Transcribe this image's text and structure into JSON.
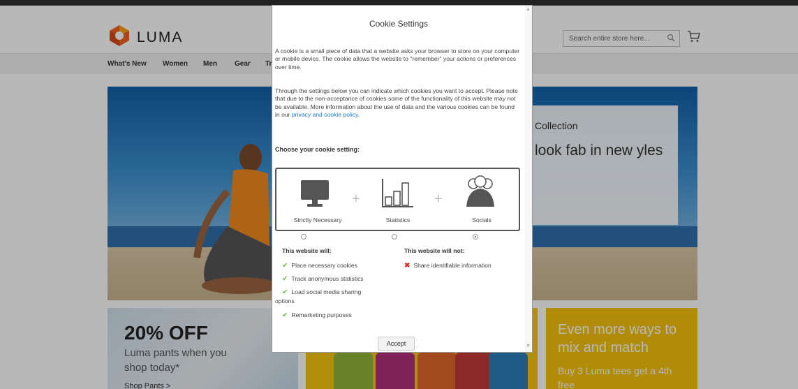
{
  "store": {
    "logo_text": "LUMA",
    "search_placeholder": "Search entire store here...",
    "nav": [
      "What's New",
      "Women",
      "Men",
      "Gear",
      "Tr"
    ],
    "hero": {
      "subtitle": "Collection",
      "title": "look fab in new yles"
    },
    "promo_pants": {
      "headline": "20% OFF",
      "text": "Luma pants when you shop today*",
      "link": "Shop Pants >"
    },
    "promo_tees": {
      "headline": "Even more ways to mix and match",
      "text": "Buy 3 Luma tees get a 4th free"
    }
  },
  "cookie_dialog": {
    "title": "Cookie Settings",
    "intro": "A cookie is a small piece of data that a website asks your browser to store on your computer or mobile device. The cookie allows the website to \"remember\" your actions or preferences over time.",
    "settings_text": "Through the settings below you can indicate which cookies you want to accept. Please note that due to the non-acceptance of cookies some of the functionality of this website may not be available. More information about the use of data and the various cookies can be found in our ",
    "policy_link": "privacy and cookie policy",
    "policy_end": ".",
    "choose_label": "Choose your cookie setting:",
    "options": [
      {
        "label": "Strictly Necessary",
        "icon": "monitor-icon",
        "selected": false
      },
      {
        "label": "Statistics",
        "icon": "bar-chart-icon",
        "selected": false
      },
      {
        "label": "Socials",
        "icon": "people-icon",
        "selected": true
      }
    ],
    "will_heading": "This website will:",
    "will_items": [
      "Place necessary cookies",
      "Track anonymous statistics",
      "Load social media sharing options",
      "Remarketing purposes"
    ],
    "will_not_heading": "This website will not:",
    "will_not_items": [
      "Share identifiable information"
    ],
    "accept_label": "Accept"
  }
}
